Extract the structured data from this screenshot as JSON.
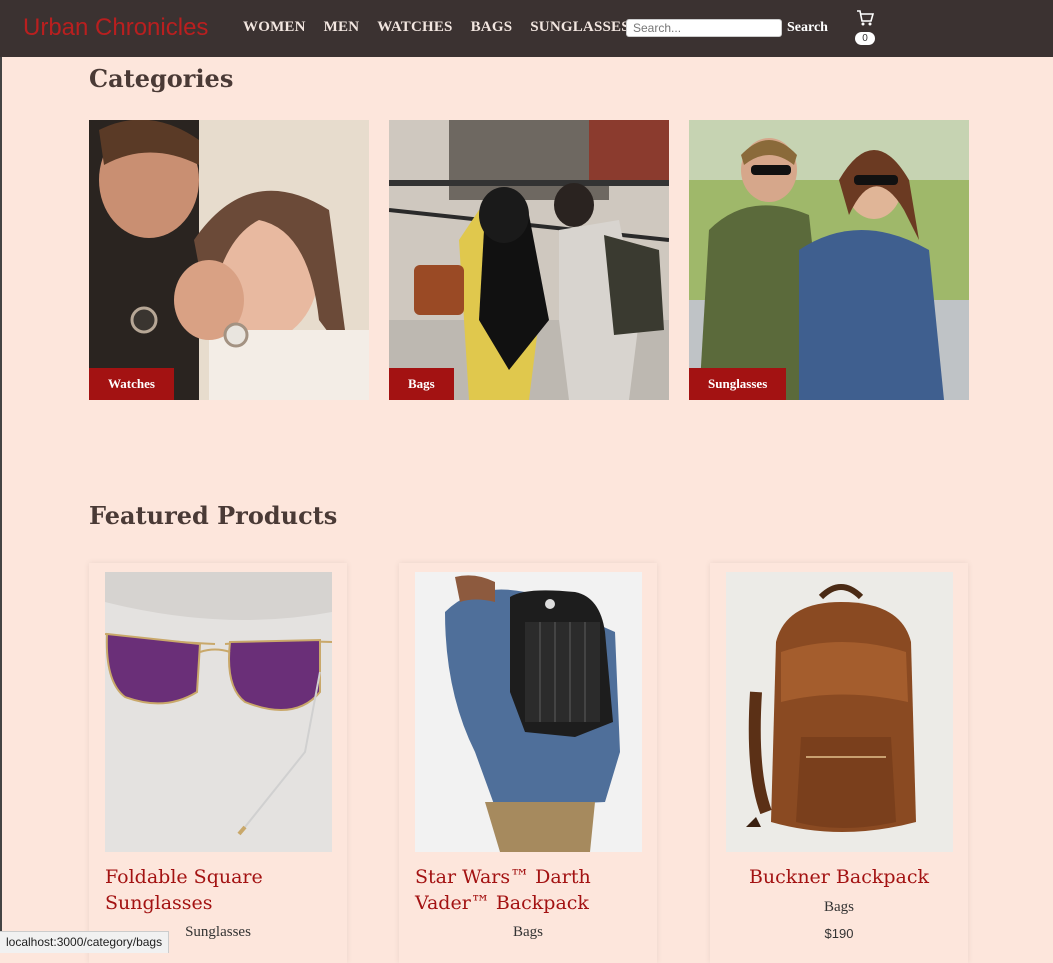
{
  "header": {
    "brand": "Urban Chronicles",
    "nav": [
      "WOMEN",
      "MEN",
      "WATCHES",
      "BAGS",
      "SUNGLASSES"
    ],
    "search_placeholder": "Search...",
    "search_button": "Search",
    "cart_count": "0"
  },
  "categories": {
    "title": "Categories",
    "items": [
      {
        "label": "Watches"
      },
      {
        "label": "Bags"
      },
      {
        "label": "Sunglasses"
      }
    ]
  },
  "featured": {
    "title": "Featured Products",
    "products": [
      {
        "name": "Foldable Square Sunglasses",
        "category": "Sunglasses"
      },
      {
        "name": "Star Wars™ Darth Vader™ Backpack",
        "category": "Bags"
      },
      {
        "name": "Buckner Backpack",
        "category": "Bags",
        "price": "$190"
      }
    ]
  },
  "status_bar": "localhost:3000/category/bags",
  "colors": {
    "header_bg": "#3b3231",
    "accent": "#a31212",
    "page_bg": "#fde6dc",
    "brand": "#b91f1f"
  }
}
